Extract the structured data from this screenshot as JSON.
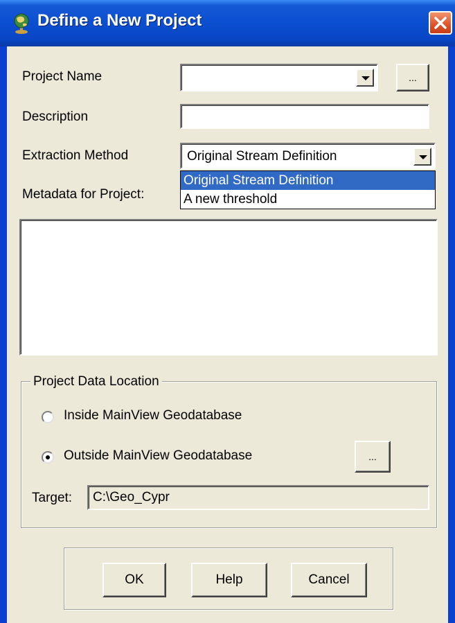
{
  "window": {
    "title": "Define a New Project",
    "icons": {
      "app": "globe-icon",
      "close": "close-icon"
    }
  },
  "form": {
    "project_name": {
      "label": "Project Name",
      "value": "",
      "browse_label": "..."
    },
    "description": {
      "label": "Description",
      "value": ""
    },
    "extraction_method": {
      "label": "Extraction Method",
      "selected": "Original Stream Definition",
      "options": [
        "Original Stream Definition",
        "A new threshold"
      ],
      "highlighted_index": 0
    },
    "metadata": {
      "label": "Metadata for Project:",
      "value": ""
    }
  },
  "location_group": {
    "legend": "Project Data Location",
    "options": [
      {
        "label": "Inside MainView Geodatabase",
        "checked": false
      },
      {
        "label": "Outside MainView Geodatabase",
        "checked": true
      }
    ],
    "browse_label": "...",
    "target": {
      "label": "Target:",
      "value": "C:\\Geo_Cypr"
    }
  },
  "buttons": {
    "ok": "OK",
    "help": "Help",
    "cancel": "Cancel"
  },
  "colors": {
    "title_bar": "#0a4fd0",
    "selection": "#316ac5",
    "dialog_bg": "#ece9d8",
    "close": "#e0522a"
  }
}
